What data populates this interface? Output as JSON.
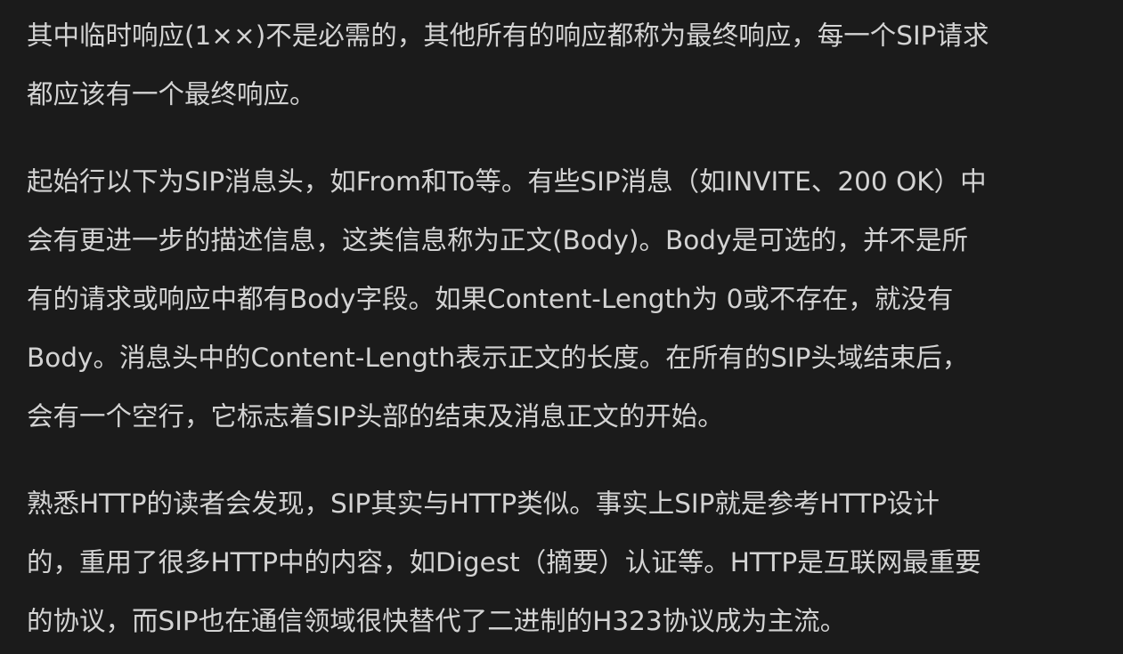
{
  "paragraphs": [
    {
      "lines": [
        "其中临时响应(1××)不是必需的，其他所有的响应都称为最终响应，每一个SIP请求",
        "都应该有一个最终响应。"
      ]
    },
    {
      "lines": [
        "起始行以下为SIP消息头，如From和To等。有些SIP消息（如INVITE、200 OK）中",
        "会有更进一步的描述信息，这类信息称为正文(Body)。Body是可选的，并不是所",
        "有的请求或响应中都有Body字段。如果Content-Length为 0或不存在，就没有",
        "Body。消息头中的Content-Length表示正文的长度。在所有的SIP头域结束后，",
        "会有一个空行，它标志着SIP头部的结束及消息正文的开始。"
      ]
    },
    {
      "lines": [
        "熟悉HTTP的读者会发现，SIP其实与HTTP类似。事实上SIP就是参考HTTP设计",
        "的，重用了很多HTTP中的内容，如Digest（摘要）认证等。HTTP是互联网最重要",
        "的协议，而SIP也在通信领域很快替代了二进制的H323协议成为主流。"
      ]
    }
  ]
}
